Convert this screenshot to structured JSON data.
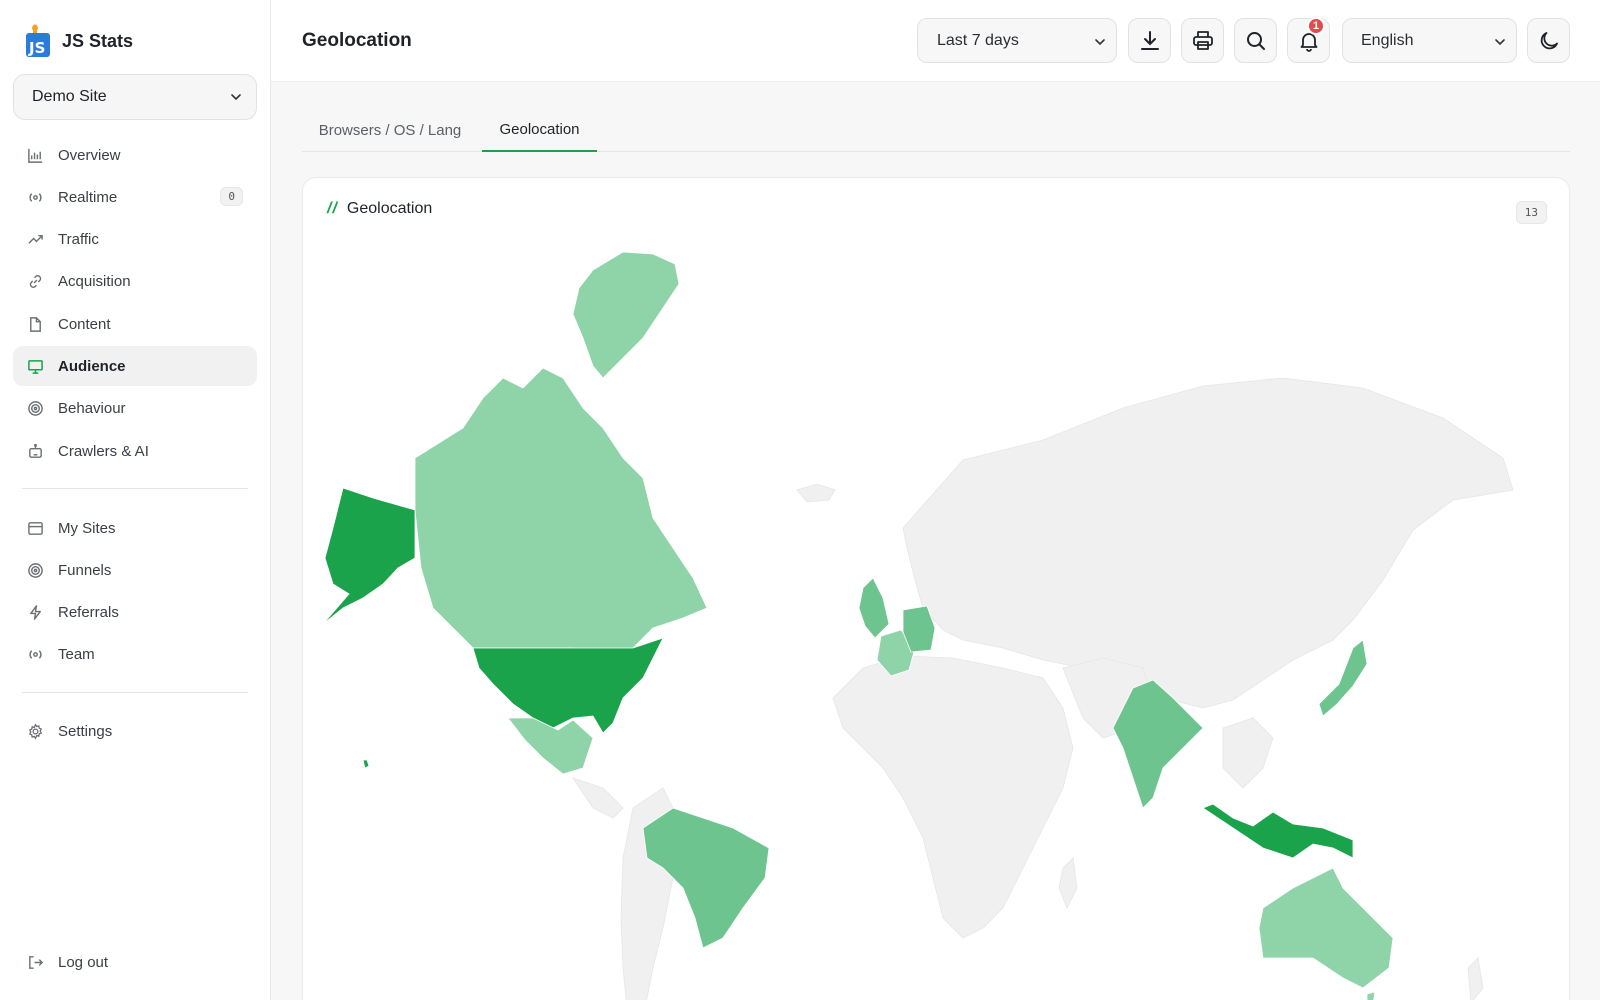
{
  "app": {
    "name": "JS Stats"
  },
  "site_select": {
    "value": "Demo Site"
  },
  "nav": {
    "items": [
      {
        "id": "overview",
        "label": "Overview",
        "icon": "bar-chart-icon"
      },
      {
        "id": "realtime",
        "label": "Realtime",
        "icon": "broadcast-icon",
        "badge": "0"
      },
      {
        "id": "traffic",
        "label": "Traffic",
        "icon": "trend-up-icon"
      },
      {
        "id": "acquisition",
        "label": "Acquisition",
        "icon": "link-icon"
      },
      {
        "id": "content",
        "label": "Content",
        "icon": "file-icon"
      },
      {
        "id": "audience",
        "label": "Audience",
        "icon": "monitor-icon",
        "active": true
      },
      {
        "id": "behaviour",
        "label": "Behaviour",
        "icon": "target-icon"
      },
      {
        "id": "crawlers",
        "label": "Crawlers & AI",
        "icon": "robot-icon"
      }
    ],
    "secondary": [
      {
        "id": "my-sites",
        "label": "My Sites",
        "icon": "browser-icon"
      },
      {
        "id": "funnels",
        "label": "Funnels",
        "icon": "target-icon"
      },
      {
        "id": "referrals",
        "label": "Referrals",
        "icon": "bolt-icon"
      },
      {
        "id": "team",
        "label": "Team",
        "icon": "broadcast-icon"
      }
    ],
    "tertiary": [
      {
        "id": "settings",
        "label": "Settings",
        "icon": "gear-icon"
      }
    ],
    "logout": "Log out"
  },
  "header": {
    "title": "Geolocation",
    "range": "Last 7 days",
    "notifications_count": "1",
    "language": "English"
  },
  "tabs": [
    {
      "label": "Browsers / OS / Lang",
      "active": false
    },
    {
      "label": "Geolocation",
      "active": true
    }
  ],
  "card": {
    "slashes": "//",
    "title": "Geolocation",
    "count": "13"
  },
  "colors": {
    "accent": "#1aa34a",
    "level_high": "#1aa34a",
    "level_mid": "#6dc48e",
    "level_low": "#8fd3a8",
    "land_empty": "#f0f0f0"
  },
  "map": {
    "countries_with_visits": [
      {
        "country": "United States",
        "level": "high"
      },
      {
        "country": "Alaska (United States)",
        "level": "high"
      },
      {
        "country": "Canada",
        "level": "low"
      },
      {
        "country": "Greenland",
        "level": "low"
      },
      {
        "country": "Mexico",
        "level": "low"
      },
      {
        "country": "Brazil",
        "level": "mid"
      },
      {
        "country": "United Kingdom",
        "level": "mid"
      },
      {
        "country": "France",
        "level": "low"
      },
      {
        "country": "Germany",
        "level": "mid"
      },
      {
        "country": "India",
        "level": "mid"
      },
      {
        "country": "Japan",
        "level": "mid"
      },
      {
        "country": "Indonesia",
        "level": "high"
      },
      {
        "country": "Australia",
        "level": "low"
      }
    ]
  }
}
